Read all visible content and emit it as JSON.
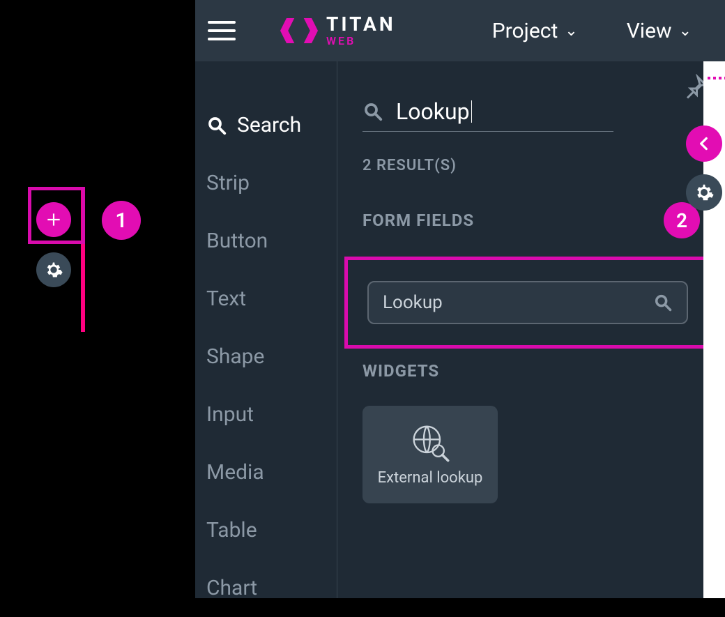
{
  "brand": {
    "title": "TITAN",
    "sub": "WEB"
  },
  "topmenu": {
    "project": "Project",
    "view": "View"
  },
  "categories": {
    "search": "Search",
    "items": [
      "Strip",
      "Button",
      "Text",
      "Shape",
      "Input",
      "Media",
      "Table",
      "Chart"
    ]
  },
  "search": {
    "value": "Lookup"
  },
  "results": {
    "count_label": "2 RESULT(S)",
    "form_fields_label": "FORM FIELDS",
    "lookup_field_label": "Lookup",
    "widgets_label": "WIDGETS",
    "external_lookup_label": "External lookup"
  },
  "callouts": {
    "one": "1",
    "two": "2"
  },
  "colors": {
    "accent": "#e20db3"
  }
}
